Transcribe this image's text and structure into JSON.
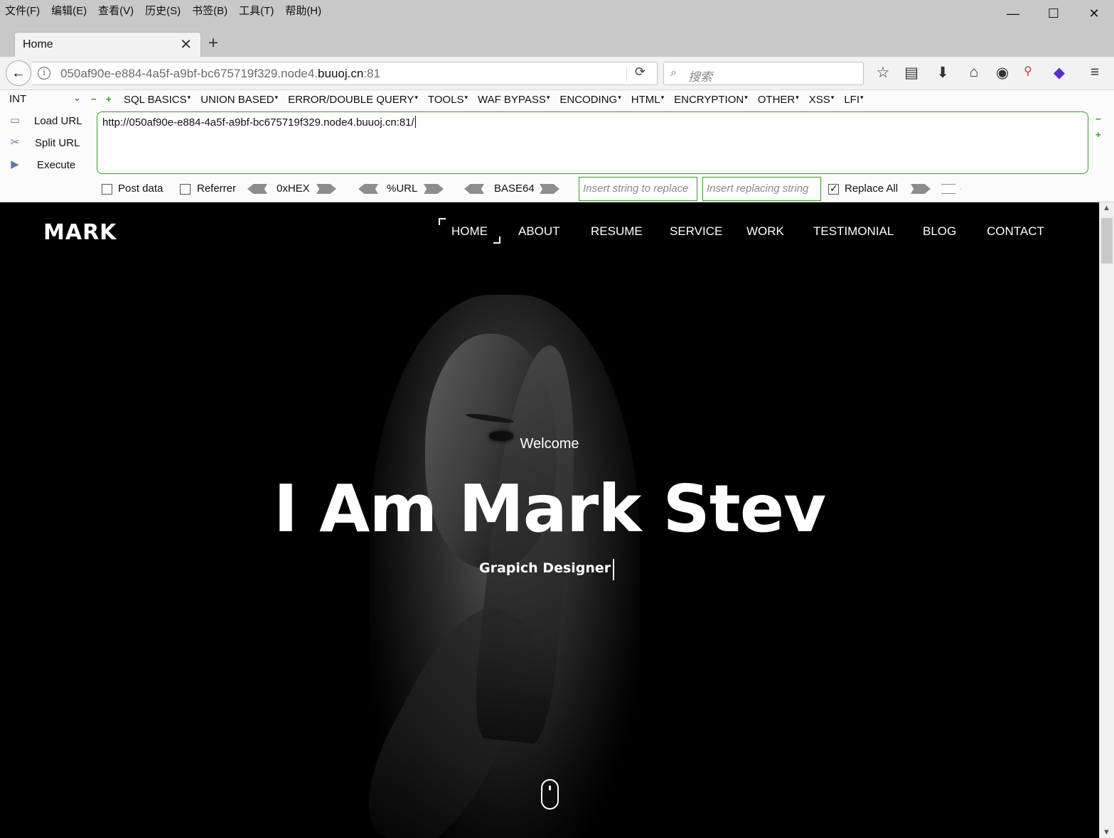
{
  "menubar": {
    "items": [
      "文件(F)",
      "编辑(E)",
      "查看(V)",
      "历史(S)",
      "书签(B)",
      "工具(T)",
      "帮助(H)"
    ]
  },
  "window_controls": {
    "minimize": "—",
    "maximize": "☐",
    "close": "✕"
  },
  "tab": {
    "title": "Home",
    "close": "✕",
    "new_tab": "+"
  },
  "navbar": {
    "url_prefix": "050af90e-e884-4a5f-a9bf-bc675719f329.node4.",
    "url_domain": "buuoj.cn",
    "url_port": ":81",
    "search_placeholder": "搜索"
  },
  "hackbar": {
    "encoding_select": "INT",
    "menus": [
      "SQL BASICS",
      "UNION BASED",
      "ERROR/DOUBLE QUERY",
      "TOOLS",
      "WAF BYPASS",
      "ENCODING",
      "HTML",
      "ENCRYPTION",
      "OTHER",
      "XSS",
      "LFI"
    ],
    "load_url": "Load URL",
    "split_url": "Split URL",
    "execute": "Execute",
    "textarea_value": "http://050af90e-e884-4a5f-a9bf-bc675719f329.node4.buuoj.cn:81/",
    "post_data": {
      "label": "Post data",
      "checked": false
    },
    "referrer": {
      "label": "Referrer",
      "checked": false
    },
    "hex_label": "0xHEX",
    "url_label": "%URL",
    "base64_label": "BASE64",
    "replace_placeholder": "Insert string to replace",
    "replacing_placeholder": "Insert replacing string",
    "replace_all": {
      "label": "Replace All",
      "checked": true
    }
  },
  "site": {
    "logo": "MARK",
    "nav": [
      "HOME",
      "ABOUT",
      "RESUME",
      "SERVICE",
      "WORK",
      "TESTIMONIAL",
      "BLOG",
      "CONTACT"
    ],
    "active_nav": "HOME",
    "welcome": "Welcome",
    "headline": "I Am Mark Stev",
    "subline": "Grapich Designer"
  }
}
